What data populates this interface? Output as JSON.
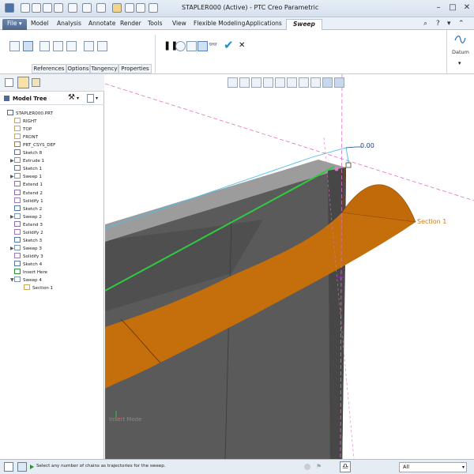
{
  "window": {
    "title": "STAPLER000 (Active) - PTC Creo Parametric"
  },
  "menu": {
    "tabs": [
      "File ▾",
      "Model",
      "Analysis",
      "Annotate",
      "Render",
      "Tools",
      "View",
      "Flexible Modeling",
      "Applications",
      "Sweep"
    ]
  },
  "ribbon": {
    "subtabs": [
      "References",
      "Options",
      "Tangency",
      "Properties"
    ],
    "datum_label": "Datum"
  },
  "model_tree": {
    "title": "Model Tree",
    "items": [
      "STAPLER000.PRT",
      "RIGHT",
      "TOP",
      "FRONT",
      "PRT_CSYS_DEF",
      "Sketch 8",
      "Extrude 1",
      "Sketch 1",
      "Sweep 1",
      "Extend 1",
      "Extend 2",
      "Solidify 1",
      "Sketch 2",
      "Sweep 2",
      "Extend 3",
      "Solidify 2",
      "Sketch 3",
      "Sweep 3",
      "Solidify 3",
      "Sketch 4",
      "Insert Here",
      "Sweep 4",
      "Section 1"
    ]
  },
  "viewport": {
    "dimension_value": "0.00",
    "section_label": "Section 1",
    "mode_label": "Insert Mode"
  },
  "status": {
    "message": "Select any number of chains as trajectories for the sweep.",
    "filter_value": "All"
  },
  "colors": {
    "sweep_surface": "#c46e0c",
    "trajectory": "#2ecc40",
    "datum_dash": "#e070c0",
    "body": "#595959"
  }
}
